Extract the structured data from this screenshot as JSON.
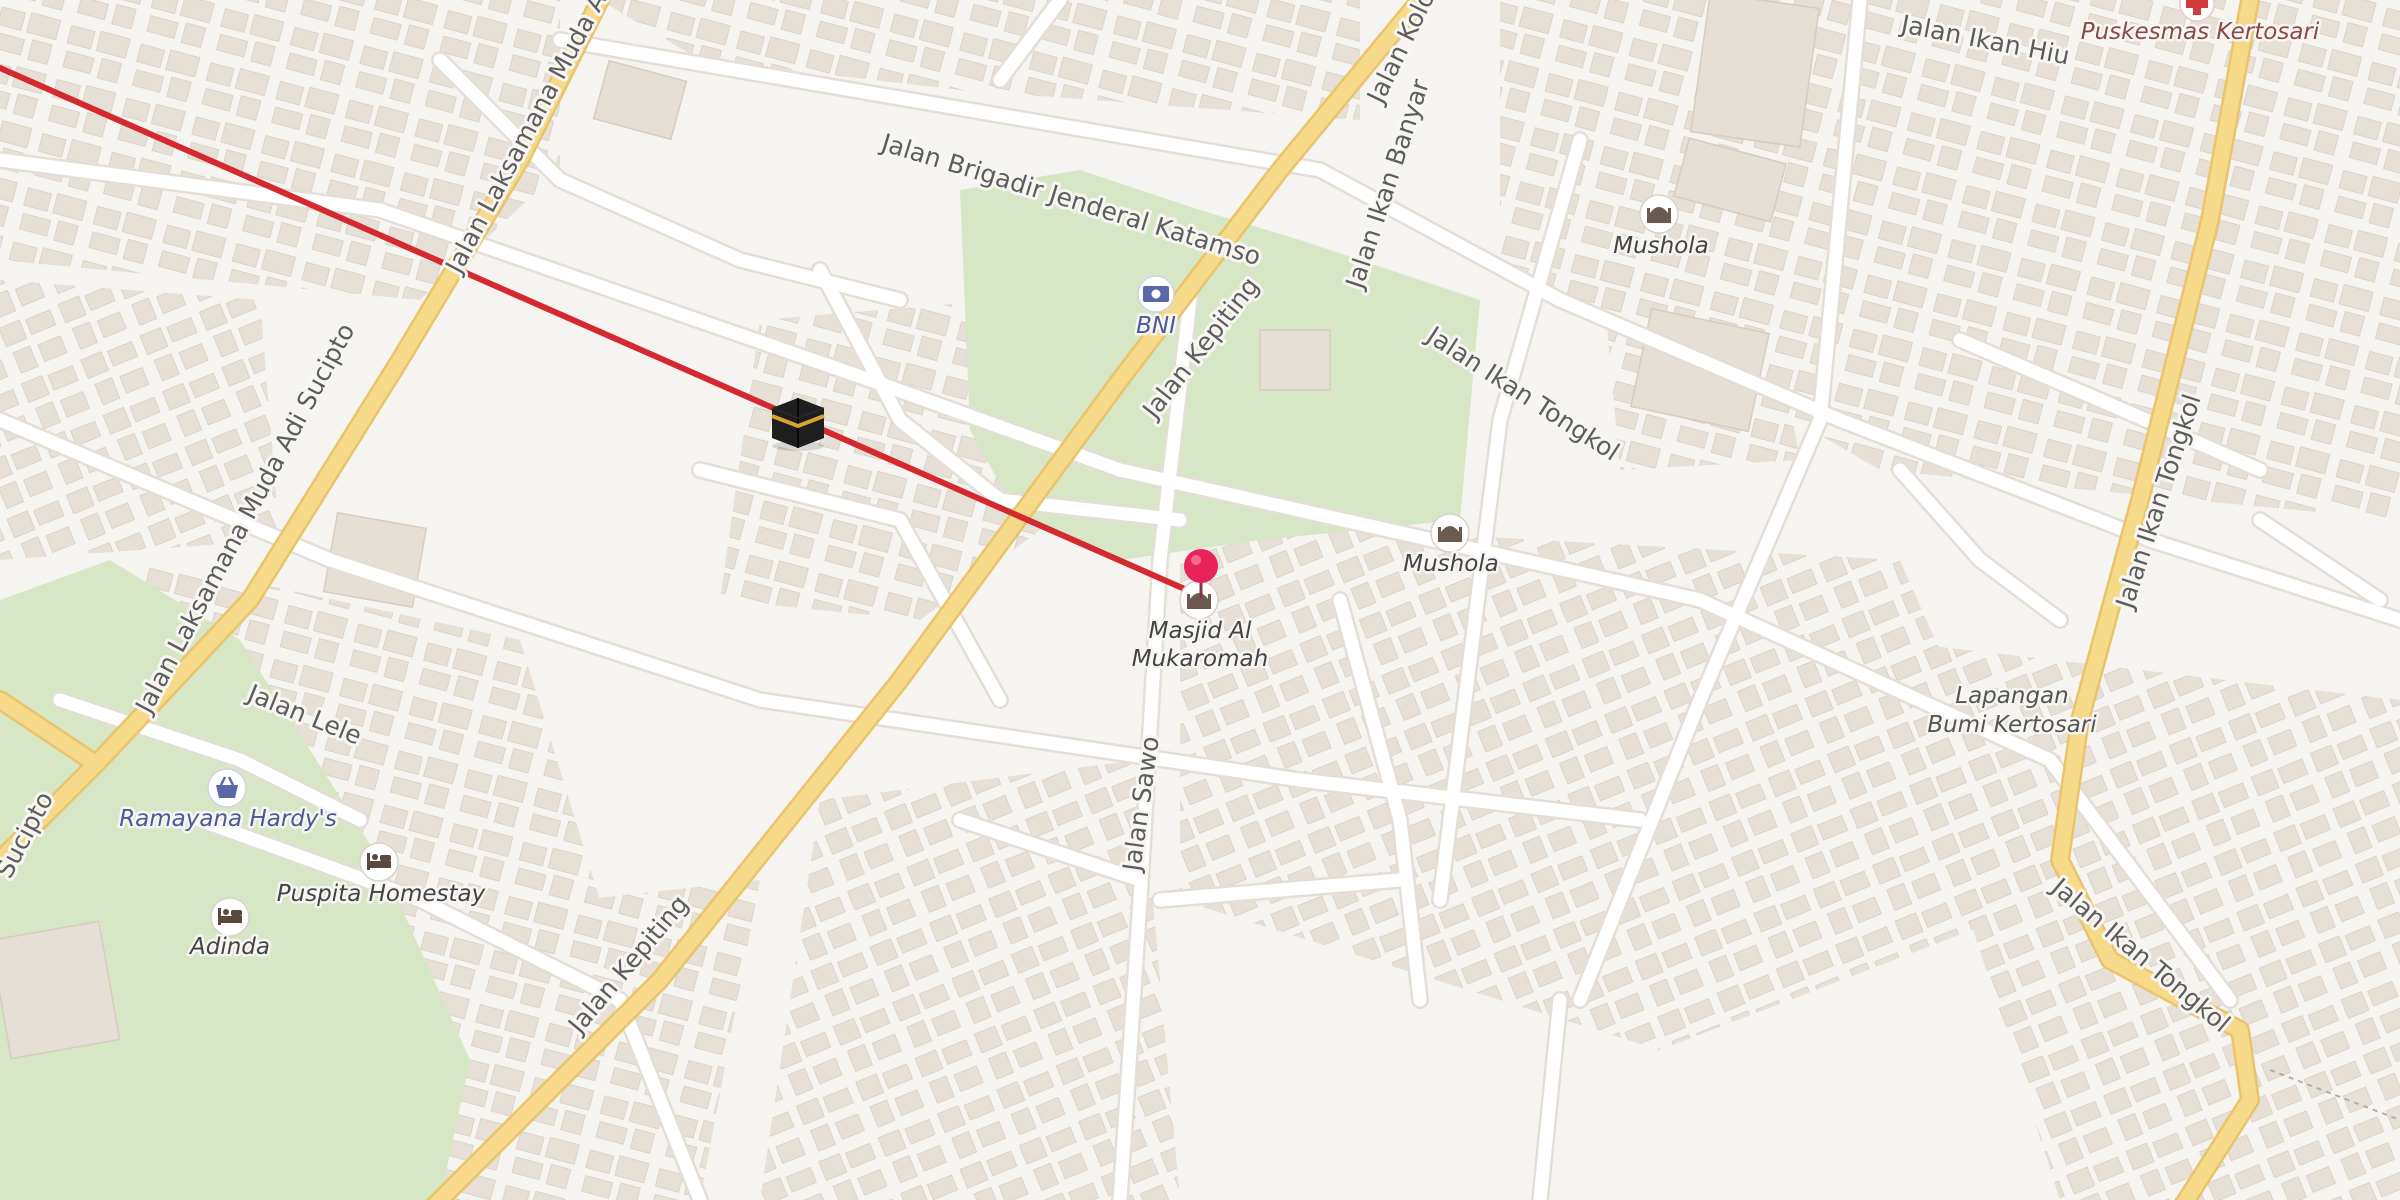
{
  "map": {
    "streets": [
      {
        "id": "brigadir",
        "text": "Jalan Brigadir Jenderal Katamso"
      },
      {
        "id": "kepiting-upper",
        "text": "Jalan Kepiting"
      },
      {
        "id": "kepiting-lower",
        "text": "Jalan Kepiting"
      },
      {
        "id": "ikan-tongkol-upper",
        "text": "Jalan Ikan Tongkol"
      },
      {
        "id": "ikan-tongkol-vertical",
        "text": "Jalan Ikan Tongkol"
      },
      {
        "id": "ikan-tongkol-lower",
        "text": "Jalan Ikan Tongkol"
      },
      {
        "id": "ikan-banyar",
        "text": "Jalan Ikan Banyar"
      },
      {
        "id": "ikan-hiu",
        "text": "Jalan Ikan Hiu"
      },
      {
        "id": "laksamana-upper",
        "text": "Jalan Laksamana Muda Adi"
      },
      {
        "id": "laksamana-lower",
        "text": "Jalan Laksamana Muda Adi Sucipto"
      },
      {
        "id": "sucipto-edge",
        "text": "Sucipto"
      },
      {
        "id": "lele",
        "text": "Jalan Lele"
      },
      {
        "id": "sawo",
        "text": "Jalan Sawo"
      },
      {
        "id": "kolo",
        "text": "Jalan Kolo"
      }
    ],
    "pois": [
      {
        "id": "bni",
        "lines": [
          "BNI"
        ],
        "icon": "bank-icon"
      },
      {
        "id": "mushola-north",
        "lines": [
          "Mushola"
        ],
        "icon": "mosque-icon"
      },
      {
        "id": "mushola-east",
        "lines": [
          "Mushola"
        ],
        "icon": "mosque-icon"
      },
      {
        "id": "masjid",
        "lines": [
          "Masjid Al",
          "Mukaromah"
        ],
        "icon": "mosque-icon"
      },
      {
        "id": "lapangan",
        "lines": [
          "Lapangan",
          "Bumi Kertosari"
        ],
        "icon": ""
      },
      {
        "id": "puskesmas",
        "lines": [
          "Puskesmas Kertosari"
        ],
        "icon": "medical-cross-icon"
      },
      {
        "id": "ramayana",
        "lines": [
          "Ramayana Hardy's"
        ],
        "icon": "shopping-basket-icon"
      },
      {
        "id": "puspita",
        "lines": [
          "Puspita Homestay"
        ],
        "icon": "bed-icon"
      },
      {
        "id": "adinda",
        "lines": [
          "Adinda"
        ],
        "icon": "bed-icon"
      }
    ],
    "overlays": {
      "qibla_line": {
        "color": "#d42a2f"
      },
      "kaaba_marker": {
        "icon": "kaaba-icon"
      },
      "location_pin": {
        "icon": "map-pin-icon",
        "color": "#e8235a"
      }
    },
    "colors": {
      "land": "#f6f4f1",
      "building": "#e6dfd6",
      "park": "#d7e6c5",
      "minor_road": "#ffffff",
      "major_road": "#f7d98a",
      "major_road_casing": "#e8c46c",
      "qibla_line": "#d42a2f",
      "pin": "#e8235a"
    }
  }
}
